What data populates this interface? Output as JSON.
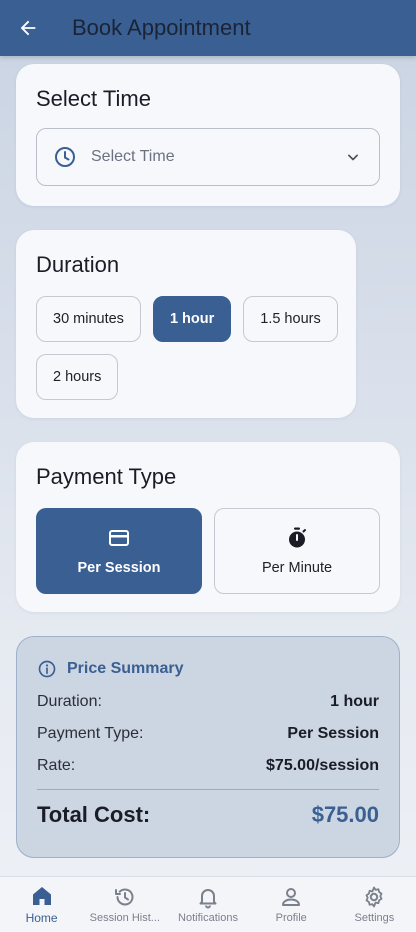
{
  "appbar": {
    "title": "Book Appointment"
  },
  "time_card": {
    "title": "Select Time",
    "placeholder": "Select Time"
  },
  "duration_card": {
    "title": "Duration",
    "options": [
      "30 minutes",
      "1 hour",
      "1.5 hours",
      "2 hours"
    ],
    "selected": "1 hour"
  },
  "payment_card": {
    "title": "Payment Type",
    "options": [
      {
        "label": "Per Session",
        "icon": "credit-card-icon"
      },
      {
        "label": "Per Minute",
        "icon": "stopwatch-icon"
      }
    ],
    "selected": "Per Session"
  },
  "summary": {
    "title": "Price Summary",
    "rows": [
      {
        "label": "Duration:",
        "value": "1 hour"
      },
      {
        "label": "Payment Type:",
        "value": "Per Session"
      },
      {
        "label": "Rate:",
        "value": "$75.00/session"
      }
    ],
    "total_label": "Total Cost:",
    "total_value": "$75.00"
  },
  "nav": {
    "items": [
      {
        "label": "Home",
        "icon": "home-icon",
        "active": true
      },
      {
        "label": "Session Hist...",
        "icon": "history-icon",
        "active": false
      },
      {
        "label": "Notifications",
        "icon": "bell-icon",
        "active": false
      },
      {
        "label": "Profile",
        "icon": "person-icon",
        "active": false
      },
      {
        "label": "Settings",
        "icon": "gear-icon",
        "active": false
      }
    ]
  },
  "colors": {
    "primary": "#3a5f92",
    "card": "#f6f8fc",
    "summary_bg": "#ccd5e2"
  }
}
